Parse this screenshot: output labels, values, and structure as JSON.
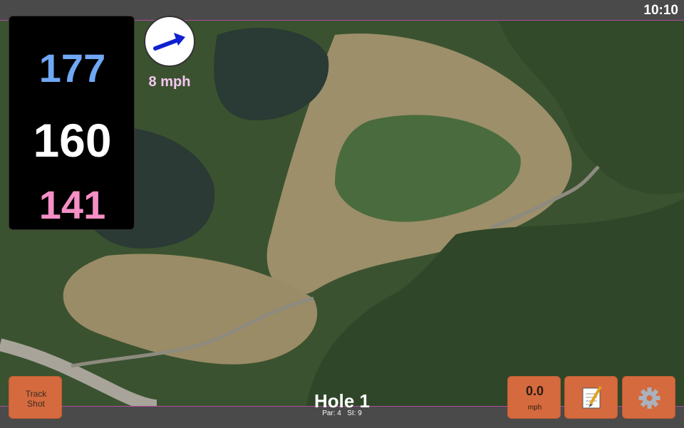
{
  "status": {
    "time": "10:10"
  },
  "yardage": {
    "back": "177",
    "middle": "160",
    "front": "141"
  },
  "wind": {
    "speed": "8 mph",
    "direction_icon": "arrow-east-icon"
  },
  "hole": {
    "title": "Hole 1",
    "par_label": "Par: 4",
    "si_label": "SI: 9"
  },
  "buttons": {
    "track_line1": "Track",
    "track_line2": "Shot",
    "speed_value": "0.0",
    "speed_unit": "mph",
    "notes_icon": "notepad-icon",
    "settings_icon": "gear-icon"
  },
  "colors": {
    "back_yardage": "#6fa8f5",
    "middle_yardage": "#ffffff",
    "front_yardage": "#f58fc6",
    "wind_text": "#f5c7f0",
    "button": "#d46a3e",
    "bar": "#4a4a4a"
  }
}
